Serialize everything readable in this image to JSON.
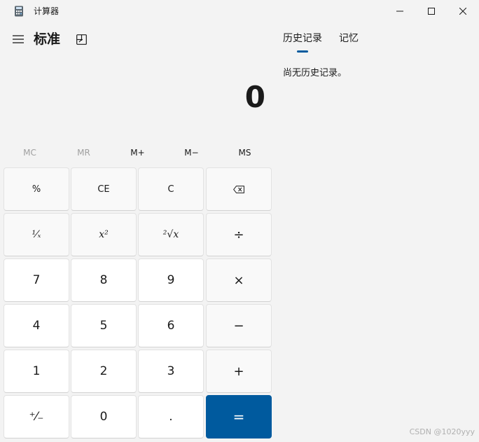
{
  "window": {
    "title": "计算器"
  },
  "header": {
    "mode_title": "标准"
  },
  "display": {
    "value": "0"
  },
  "memory": {
    "mc": "MC",
    "mr": "MR",
    "m_plus": "M+",
    "m_minus": "M−",
    "ms": "MS"
  },
  "keys": {
    "percent": "%",
    "ce": "CE",
    "clear": "C",
    "backspace": "⌫",
    "reciprocal": "¹⁄ₓ",
    "square": "x²",
    "sqrt": "²√x",
    "divide": "÷",
    "n7": "7",
    "n8": "8",
    "n9": "9",
    "multiply": "×",
    "n4": "4",
    "n5": "5",
    "n6": "6",
    "minus": "−",
    "n1": "1",
    "n2": "2",
    "n3": "3",
    "plus": "+",
    "negate": "⁺⁄₋",
    "n0": "0",
    "decimal": ".",
    "equals": "="
  },
  "side_panel": {
    "tabs": [
      {
        "label": "历史记录",
        "active": true
      },
      {
        "label": "记忆",
        "active": false
      }
    ],
    "history_empty": "尚无历史记录。"
  },
  "watermark": "CSDN @1020yyy",
  "colors": {
    "background": "#f3f3f3",
    "accent": "#005a9e",
    "number_key": "#ffffff",
    "operator_key": "#f9f9f9"
  }
}
